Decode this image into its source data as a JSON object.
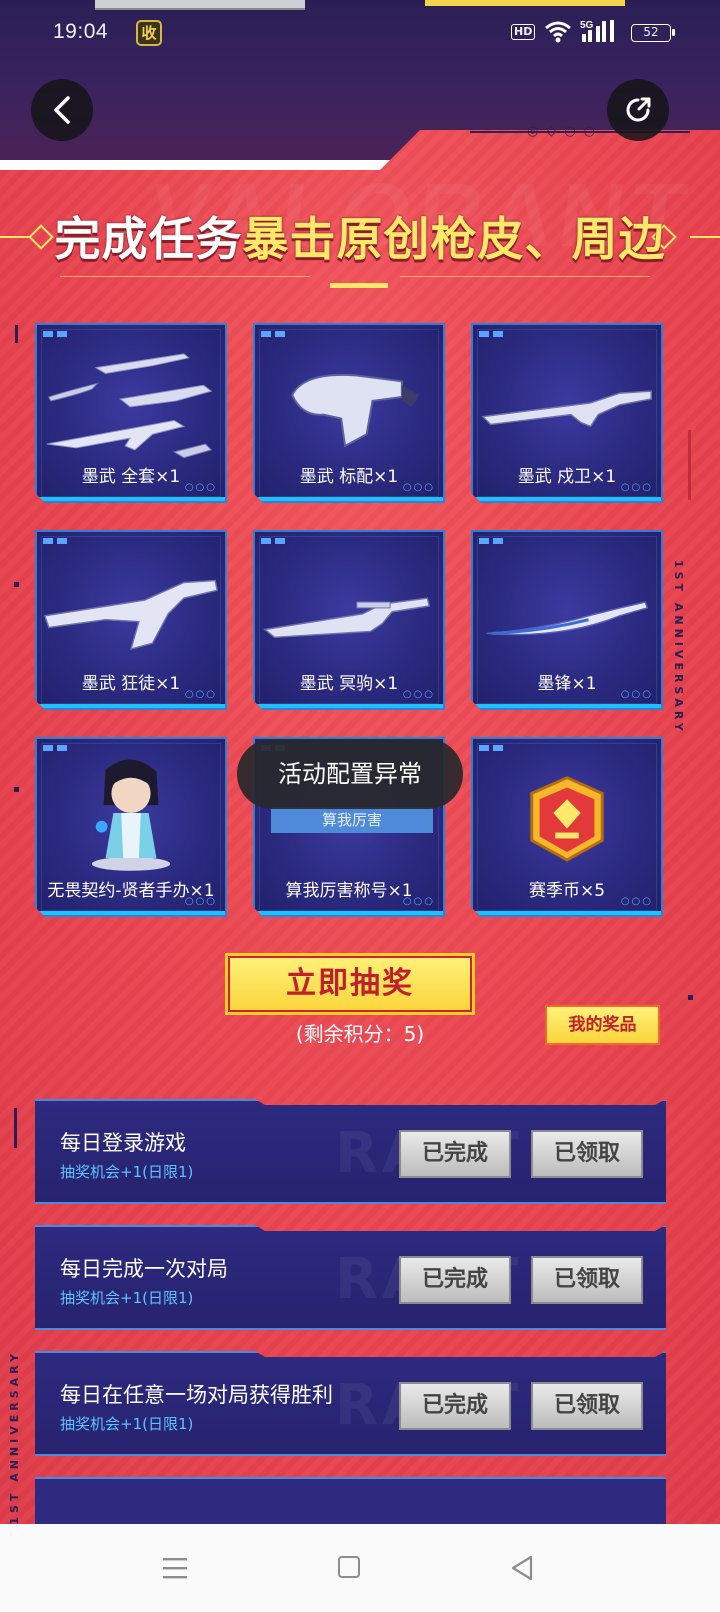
{
  "status_bar": {
    "time": "19:04",
    "app_badge": "收",
    "hd": "HD",
    "network": "5G",
    "battery": "52"
  },
  "icons": {
    "back": "chevron-left-icon",
    "share": "share-icon"
  },
  "heading": {
    "part1": "完成任务",
    "part2": "暴击原创枪皮、周边"
  },
  "watermark": "VALORANT",
  "side_text": {
    "right": "1ST ANNIVERSARY",
    "left": "1ST ANNIVERSARY"
  },
  "prizes": [
    {
      "label": "墨武 全套×1",
      "art": "weapon-set"
    },
    {
      "label": "墨武 标配×1",
      "art": "pistol"
    },
    {
      "label": "墨武 戍卫×1",
      "art": "rifle"
    },
    {
      "label": "墨武 狂徒×1",
      "art": "rifle"
    },
    {
      "label": "墨武 冥驹×1",
      "art": "sniper"
    },
    {
      "label": "墨锋×1",
      "art": "knife"
    },
    {
      "label": "无畏契约-贤者手办×1",
      "art": "figure"
    },
    {
      "label": "算我厉害称号×1",
      "art": "title-badge"
    },
    {
      "label": "赛季币×5",
      "art": "coin"
    }
  ],
  "title_badge_text": "算我厉害",
  "toast": "活动配置异常",
  "draw": {
    "button": "立即抽奖",
    "remaining": "(剩余积分：5)",
    "my_prizes": "我的奖品"
  },
  "tasks": [
    {
      "title": "每日登录游戏",
      "sub": "抽奖机会+1(日限1)",
      "done": "已完成",
      "claimed": "已领取"
    },
    {
      "title": "每日完成一次对局",
      "sub": "抽奖机会+1(日限1)",
      "done": "已完成",
      "claimed": "已领取"
    },
    {
      "title": "每日在任意一场对局获得胜利",
      "sub": "抽奖机会+1(日限1)",
      "done": "已完成",
      "claimed": "已领取"
    }
  ],
  "colors": {
    "accent_red": "#e8434f",
    "accent_yellow": "#fde86a",
    "card_blue": "#2b2a80",
    "task_sub": "#5ec4ff"
  },
  "nav": {
    "menu": "menu-icon",
    "home": "home-icon",
    "back": "back-triangle-icon"
  }
}
